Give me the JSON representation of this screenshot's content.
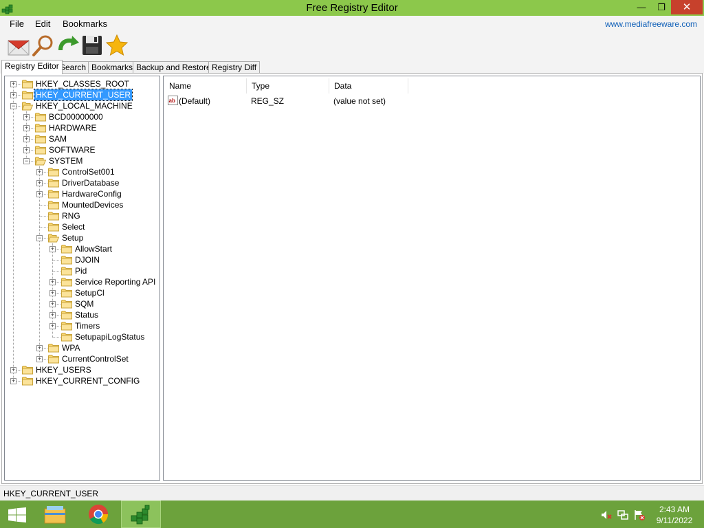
{
  "window": {
    "title": "Free Registry Editor",
    "close_glyph": "✕",
    "minimize_glyph": "—",
    "restore_glyph": "❐"
  },
  "menu": {
    "file": "File",
    "edit": "Edit",
    "bookmarks": "Bookmarks",
    "site_link": "www.mediafreeware.com"
  },
  "toolbar": {
    "icons": [
      "mail-icon",
      "search-icon",
      "refresh-icon",
      "save-icon",
      "bookmark-star-icon"
    ]
  },
  "tabs": [
    {
      "label": "Registry Editor",
      "active": true
    },
    {
      "label": "Search",
      "active": false
    },
    {
      "label": "Bookmarks",
      "active": false
    },
    {
      "label": "Backup and Restore",
      "active": false
    },
    {
      "label": "Registry Diff",
      "active": false
    }
  ],
  "tree": {
    "nodes": [
      {
        "label": "HKEY_CLASSES_ROOT",
        "depth": 0,
        "expander": "+",
        "open": false,
        "selected": false
      },
      {
        "label": "HKEY_CURRENT_USER",
        "depth": 0,
        "expander": "+",
        "open": false,
        "selected": true
      },
      {
        "label": "HKEY_LOCAL_MACHINE",
        "depth": 0,
        "expander": "-",
        "open": true,
        "selected": false
      },
      {
        "label": "BCD00000000",
        "depth": 1,
        "expander": "+",
        "open": false,
        "selected": false
      },
      {
        "label": "HARDWARE",
        "depth": 1,
        "expander": "+",
        "open": false,
        "selected": false
      },
      {
        "label": "SAM",
        "depth": 1,
        "expander": "+",
        "open": false,
        "selected": false
      },
      {
        "label": "SOFTWARE",
        "depth": 1,
        "expander": "+",
        "open": false,
        "selected": false
      },
      {
        "label": "SYSTEM",
        "depth": 1,
        "expander": "-",
        "open": true,
        "selected": false
      },
      {
        "label": "ControlSet001",
        "depth": 2,
        "expander": "+",
        "open": false,
        "selected": false
      },
      {
        "label": "DriverDatabase",
        "depth": 2,
        "expander": "+",
        "open": false,
        "selected": false
      },
      {
        "label": "HardwareConfig",
        "depth": 2,
        "expander": "+",
        "open": false,
        "selected": false
      },
      {
        "label": "MountedDevices",
        "depth": 2,
        "expander": "",
        "open": false,
        "selected": false
      },
      {
        "label": "RNG",
        "depth": 2,
        "expander": "",
        "open": false,
        "selected": false
      },
      {
        "label": "Select",
        "depth": 2,
        "expander": "",
        "open": false,
        "selected": false
      },
      {
        "label": "Setup",
        "depth": 2,
        "expander": "-",
        "open": true,
        "selected": false
      },
      {
        "label": "AllowStart",
        "depth": 3,
        "expander": "+",
        "open": false,
        "selected": false
      },
      {
        "label": "DJOIN",
        "depth": 3,
        "expander": "",
        "open": false,
        "selected": false
      },
      {
        "label": "Pid",
        "depth": 3,
        "expander": "",
        "open": false,
        "selected": false
      },
      {
        "label": "Service Reporting API",
        "depth": 3,
        "expander": "+",
        "open": false,
        "selected": false
      },
      {
        "label": "SetupCl",
        "depth": 3,
        "expander": "+",
        "open": false,
        "selected": false
      },
      {
        "label": "SQM",
        "depth": 3,
        "expander": "+",
        "open": false,
        "selected": false
      },
      {
        "label": "Status",
        "depth": 3,
        "expander": "+",
        "open": false,
        "selected": false
      },
      {
        "label": "Timers",
        "depth": 3,
        "expander": "+",
        "open": false,
        "selected": false
      },
      {
        "label": "SetupapiLogStatus",
        "depth": 3,
        "expander": "",
        "open": false,
        "selected": false
      },
      {
        "label": "WPA",
        "depth": 2,
        "expander": "+",
        "open": false,
        "selected": false
      },
      {
        "label": "CurrentControlSet",
        "depth": 2,
        "expander": "+",
        "open": false,
        "selected": false
      },
      {
        "label": "HKEY_USERS",
        "depth": 0,
        "expander": "+",
        "open": false,
        "selected": false
      },
      {
        "label": "HKEY_CURRENT_CONFIG",
        "depth": 0,
        "expander": "+",
        "open": false,
        "selected": false
      }
    ]
  },
  "list": {
    "columns": [
      "Name",
      "Type",
      "Data"
    ],
    "rows": [
      {
        "icon": "string-value-icon",
        "name": "(Default)",
        "type": "REG_SZ",
        "data": "(value not set)"
      }
    ]
  },
  "status": {
    "path": "HKEY_CURRENT_USER"
  },
  "taskbar": {
    "apps": [
      "windows-start-icon",
      "file-explorer-icon",
      "chrome-icon",
      "registry-editor-app-icon"
    ],
    "tray": [
      "volume-muted-icon",
      "network-icon",
      "action-center-flag-icon"
    ],
    "time": "2:43 AM",
    "date": "9/11/2022"
  },
  "colors": {
    "titlebar": "#8cc84b",
    "taskbar": "#6ca23c",
    "selection": "#3399ff",
    "link": "#1060b8",
    "close_button": "#c7412c"
  }
}
